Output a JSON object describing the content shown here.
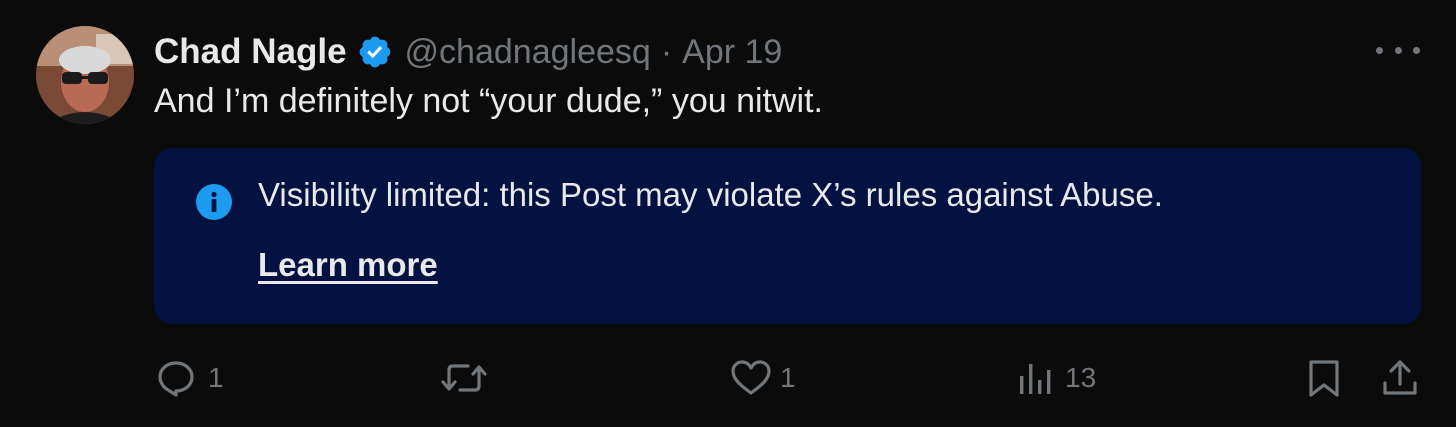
{
  "post": {
    "author_name": "Chad Nagle",
    "handle": "@chadnagleesq",
    "separator": "·",
    "date": "Apr 19",
    "text": "And I’m definitely not “your dude,” you nitwit.",
    "notice": {
      "text": "Visibility limited: this Post may violate X’s rules against Abuse.",
      "link_label": "Learn more"
    }
  },
  "actions": {
    "replies": "1",
    "reposts": "",
    "likes": "1",
    "views": "13"
  },
  "colors": {
    "background": "#0b0b0b",
    "text": "#e7e9ea",
    "muted": "#71767b",
    "verified": "#1d9bf0",
    "notice_bg": "#031240",
    "info_icon": "#1d9bf0"
  },
  "icons": {
    "verified": "verified-badge-icon",
    "more": "more-icon",
    "info": "info-icon",
    "reply": "reply-icon",
    "repost": "repost-icon",
    "like": "heart-icon",
    "views": "views-icon",
    "bookmark": "bookmark-icon",
    "share": "share-icon"
  }
}
